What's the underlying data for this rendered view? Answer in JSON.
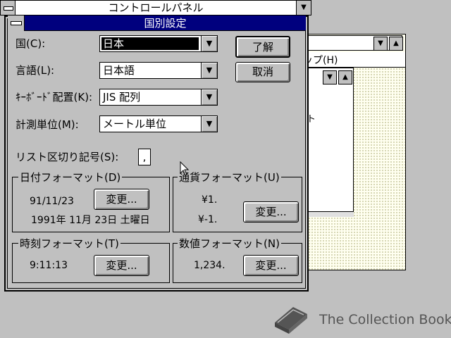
{
  "background": {
    "control_panel_title": "コントロールパネル",
    "help_menu": "ップ(H)",
    "inner_text": "ト"
  },
  "dialog": {
    "title": "国別設定",
    "ok_label": "了解",
    "cancel_label": "取消",
    "fields": {
      "country": {
        "label": "国(C):",
        "value": "日本"
      },
      "language": {
        "label": "言語(L):",
        "value": "日本語"
      },
      "keyboard": {
        "label": "ｷｰﾎﾞｰﾄﾞ配置(K):",
        "value": "JIS 配列"
      },
      "measure": {
        "label": "計測単位(M):",
        "value": "メートル単位"
      },
      "list_sep": {
        "label": "リスト区切り記号(S):",
        "value": ","
      }
    },
    "date_format": {
      "title": "日付フォーマット(D)",
      "short": "91/11/23",
      "long": "1991年 11月 23日 土曜日",
      "change_label": "変更..."
    },
    "currency_format": {
      "title": "通貨フォーマット(U)",
      "positive": "¥1.",
      "negative": "¥-1.",
      "change_label": "変更..."
    },
    "time_format": {
      "title": "時刻フォーマット(T)",
      "value": "9:11:13",
      "change_label": "変更..."
    },
    "number_format": {
      "title": "数値フォーマット(N)",
      "value": "1,234.",
      "change_label": "変更..."
    }
  },
  "watermark": {
    "text": "The Collection Book"
  },
  "colors": {
    "title_bar": "#00007e",
    "face": "#c0c0c0",
    "desktop": "#c0c0c0"
  },
  "icons": [
    "system-menu-icon",
    "dropdown-arrow-icon",
    "minimize-icon",
    "book-icon",
    "mouse-cursor-icon"
  ]
}
